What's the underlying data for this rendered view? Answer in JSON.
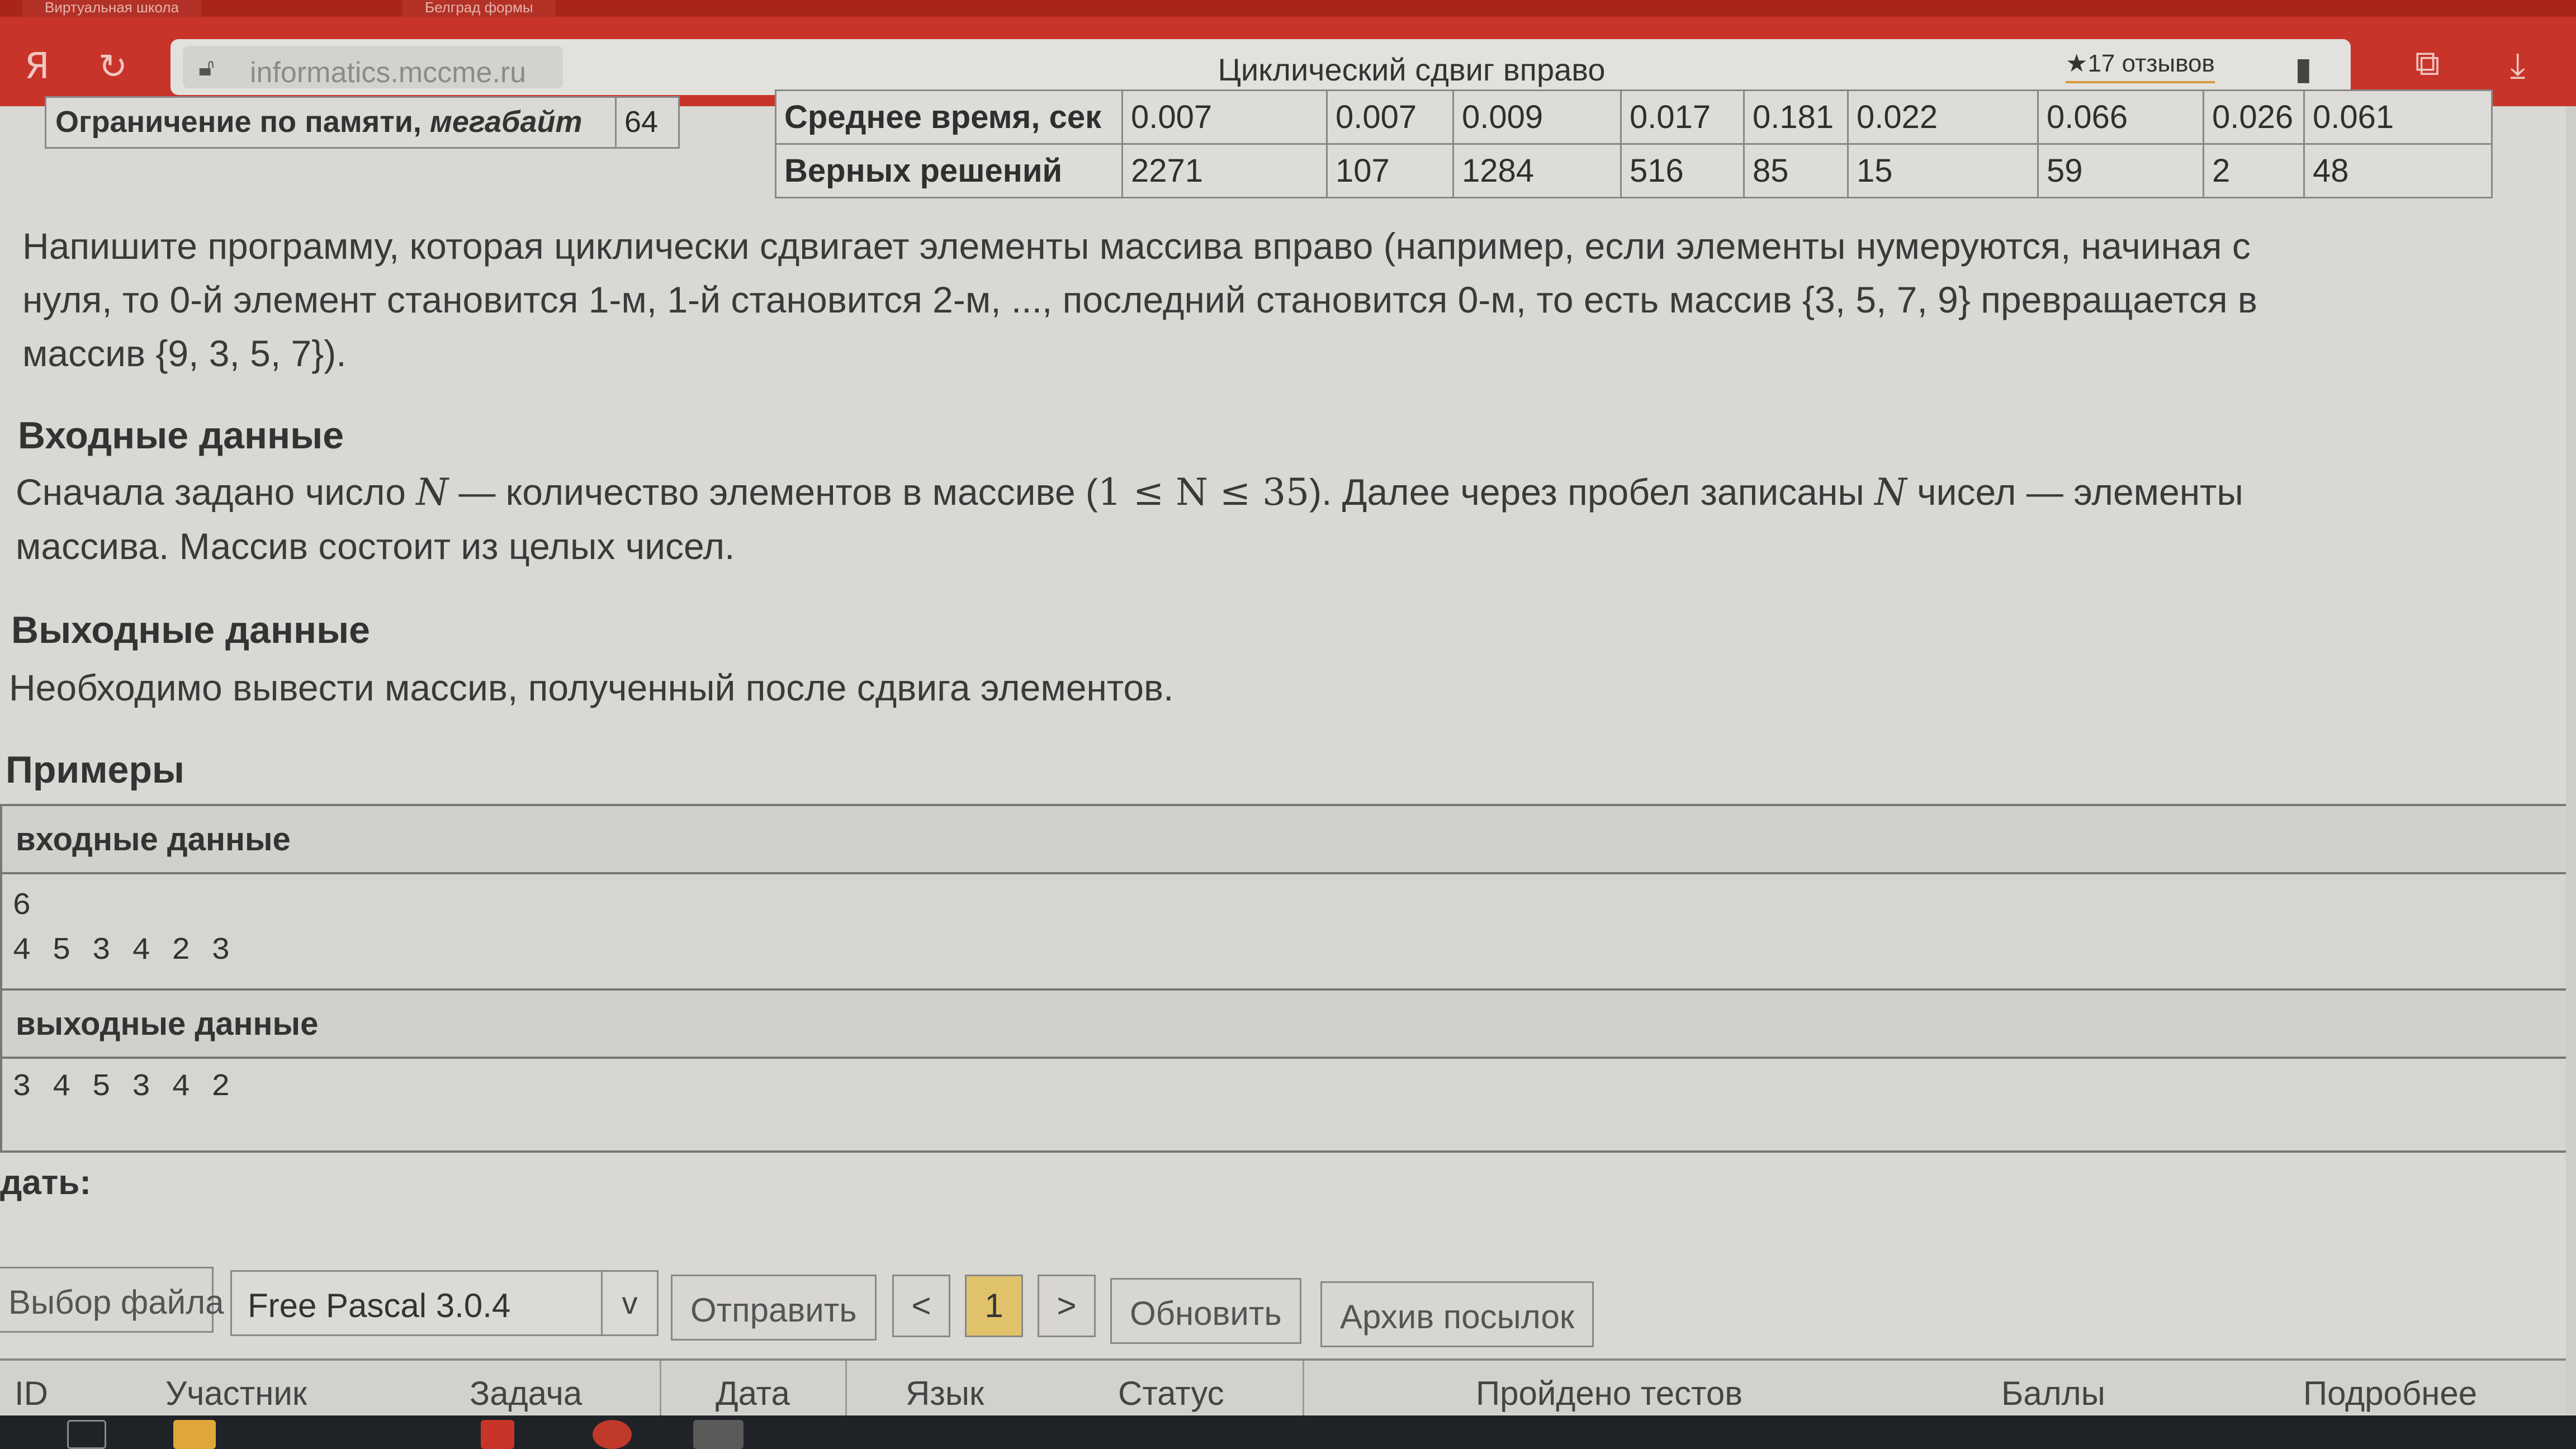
{
  "browser": {
    "tab_labels": [
      "Виртуальная школа",
      "Белград формы"
    ],
    "logo_glyph": "Я",
    "url": "informatics.mccme.ru",
    "page_title": "Циклический сдвиг вправо",
    "reviews": "★17 отзывов"
  },
  "limits": {
    "memory_label_prefix": "Ограничение по памяти, ",
    "memory_label_unit": "мегабайт",
    "memory_value": "64"
  },
  "stats": {
    "avg_time_label": "Среднее время, сек",
    "avg_time_values": [
      "0.007",
      "0.007",
      "0.009",
      "0.017",
      "0.181",
      "0.022",
      "0.066",
      "0.026",
      "0.061"
    ],
    "correct_label": "Верных решений",
    "correct_values": [
      "2271",
      "107",
      "1284",
      "516",
      "85",
      "15",
      "59",
      "2",
      "48"
    ]
  },
  "statement": {
    "line1": "Напишите программу, которая циклически сдвигает элементы массива вправо (например, если элементы нумеруются, начиная с",
    "line2": "нуля, то 0-й элемент становится 1-м, 1-й становится 2-м, ..., последний становится 0-м, то есть массив {3, 5, 7, 9} превращается в",
    "line3": "массив {9, 3, 5, 7})."
  },
  "input_section": {
    "heading": "Входные данные",
    "line1_a": "Сначала задано число ",
    "var_n": "N",
    "line1_b": " — количество элементов в массиве (",
    "range": "1 ≤ N ≤ 35",
    "line1_c": "). Далее через пробел записаны ",
    "line1_d": " чисел — элементы",
    "line2": "массива. Массив состоит из целых чисел."
  },
  "output_section": {
    "heading": "Выходные данные",
    "text": "Необходимо вывести массив, полученный после сдвига элементов."
  },
  "examples": {
    "heading": "Примеры",
    "input_label": "входные данные",
    "input_lines": [
      "6",
      "4 5 3 4 2 3"
    ],
    "output_label": "выходные данные",
    "output_lines": [
      "3 4 5 3 4 2"
    ]
  },
  "submit": {
    "label": "дать:",
    "choose_file": "Выбор файла",
    "compiler": "Free Pascal 3.0.4",
    "dropdown_glyph": "v",
    "send": "Отправить",
    "prev": "<",
    "page": "1",
    "next": ">",
    "refresh": "Обновить",
    "archive": "Архив посылок"
  },
  "results_columns": [
    "ID",
    "Участник",
    "Задача",
    "Дата",
    "Язык",
    "Статус",
    "Пройдено тестов",
    "Баллы",
    "Подробнее"
  ],
  "colors": {
    "browser_red": "#c8342a",
    "page_bg": "#d9d8d4",
    "active_page": "#e0c26a"
  }
}
